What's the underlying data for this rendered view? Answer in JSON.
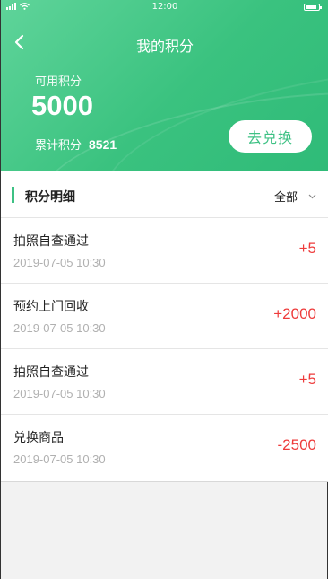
{
  "status_bar": {
    "time": "12:00"
  },
  "nav": {
    "title": "我的积分"
  },
  "summary": {
    "available_label": "可用积分",
    "available_value": "5000",
    "total_label": "累计积分",
    "total_value": "8521",
    "exchange_label": "去兑换"
  },
  "detail": {
    "title": "积分明细",
    "filter_label": "全部"
  },
  "records": [
    {
      "title": "拍照自查通过",
      "time": "2019-07-05  10:30",
      "points": "+5"
    },
    {
      "title": "预约上门回收",
      "time": "2019-07-05  10:30",
      "points": "+2000"
    },
    {
      "title": "拍照自查通过",
      "time": "2019-07-05  10:30",
      "points": "+5"
    },
    {
      "title": "兑换商品",
      "time": "2019-07-05  10:30",
      "points": "-2500"
    }
  ],
  "icons": {
    "back": "chevron-left-icon",
    "filter": "chevron-down-icon",
    "signal": "signal-icon",
    "wifi": "wifi-icon",
    "battery": "battery-icon"
  },
  "colors": {
    "brand_green": "#3ec184",
    "points_red": "#ee3b3b"
  }
}
